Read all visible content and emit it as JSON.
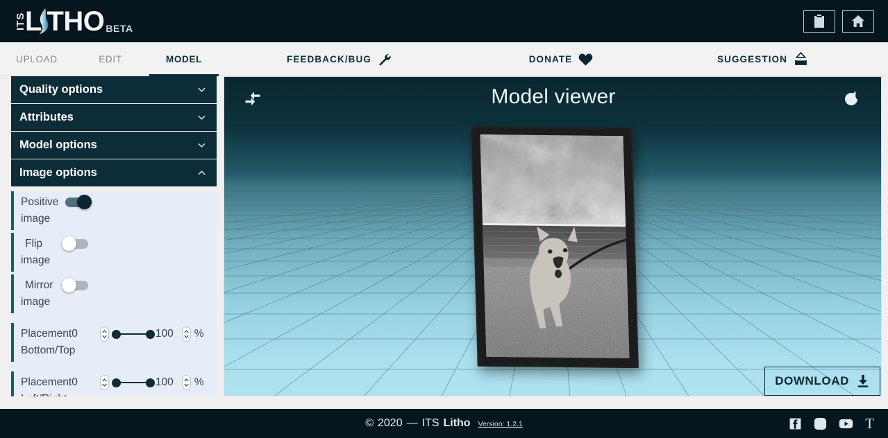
{
  "header": {
    "logo": {
      "its": "ITS",
      "l": "L",
      "tho": "THO",
      "beta": "BETA",
      "flame_icon": "flame-icon"
    },
    "buttons": [
      {
        "name": "notes-button",
        "icon": "clipboard-icon"
      },
      {
        "name": "home-button",
        "icon": "home-icon"
      }
    ]
  },
  "nav": {
    "tabs": [
      {
        "label": "UPLOAD",
        "active": false
      },
      {
        "label": "EDIT",
        "active": false
      },
      {
        "label": "MODEL",
        "active": true
      }
    ],
    "links": [
      {
        "label": "FEEDBACK/BUG",
        "icon": "wrench-icon"
      },
      {
        "label": "DONATE",
        "icon": "heart-icon"
      },
      {
        "label": "SUGGESTION",
        "icon": "ballot-box-icon"
      }
    ]
  },
  "sidebar": {
    "sections": [
      {
        "title": "Quality options",
        "expanded": false,
        "icon": "chevron-down-icon"
      },
      {
        "title": "Attributes",
        "expanded": false,
        "icon": "chevron-down-icon"
      },
      {
        "title": "Model options",
        "expanded": false,
        "icon": "chevron-down-icon"
      },
      {
        "title": "Image options",
        "expanded": true,
        "icon": "chevron-up-icon"
      }
    ],
    "image_options": {
      "toggles": [
        {
          "label_1": "Positive",
          "label_2": "image",
          "state": "on"
        },
        {
          "label_1": "Flip",
          "label_2": "image",
          "state": "off"
        },
        {
          "label_1": "Mirror",
          "label_2": "image",
          "state": "off"
        }
      ],
      "ranges": [
        {
          "label_1": "Placement",
          "label_2": "Bottom/Top",
          "min_value": "0",
          "max_value": "100",
          "unit": "%"
        },
        {
          "label_1": "Placement",
          "label_2": "Left/Right",
          "min_value": "0",
          "max_value": "100",
          "unit": "%"
        }
      ]
    }
  },
  "viewer": {
    "title": "Model viewer",
    "left_icon": "compare-arrows-icon",
    "right_icon": "refresh-icon",
    "download_label": "DOWNLOAD",
    "download_icon": "download-icon",
    "scene": {
      "description": "3D perspective grid floor with framed grayscale lithophane of a dog on a beach",
      "sky_color": "#0b2c39",
      "floor_color": "#ace0ef",
      "frame_color": "#1c1c1c"
    }
  },
  "footer": {
    "copyright_symbol": "©",
    "year": "2020",
    "dash": "—",
    "brand_light": "ITS",
    "brand_bold": "Litho",
    "version": "Version: 1.2.1",
    "socials": [
      {
        "name": "facebook-icon",
        "label": "f"
      },
      {
        "name": "instagram-icon",
        "label": ""
      },
      {
        "name": "youtube-icon",
        "label": ""
      },
      {
        "name": "thingiverse-icon",
        "label": "T"
      }
    ]
  },
  "colors": {
    "dark": "#06161f",
    "accordion": "#0c2c37",
    "accent_teal": "#10616f",
    "panel_bg": "#e6edf8",
    "nav_bg": "#f2f2f2"
  }
}
